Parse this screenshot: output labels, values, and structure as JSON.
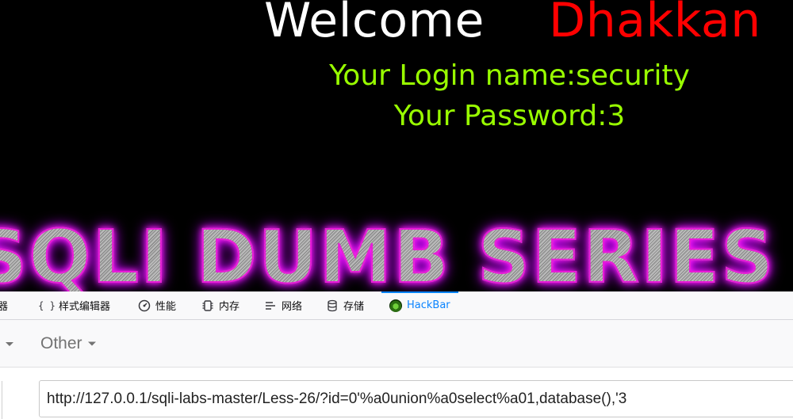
{
  "page": {
    "welcome": "Welcome",
    "username_display": "Dhakkan",
    "login_line": "Your Login name:security",
    "password_line": "Your Password:3",
    "banner": "SQLI DUMB SERIES"
  },
  "devtools": {
    "tabs": [
      {
        "label": "器",
        "icon": "partial-icon"
      },
      {
        "label": "样式编辑器",
        "icon": "braces-icon"
      },
      {
        "label": "性能",
        "icon": "gauge-icon"
      },
      {
        "label": "内存",
        "icon": "memory-chip-icon"
      },
      {
        "label": "网络",
        "icon": "network-lines-icon"
      },
      {
        "label": "存储",
        "icon": "database-icon"
      },
      {
        "label": "HackBar",
        "icon": "hackbar-logo-icon",
        "active": true
      }
    ],
    "accent_color": "#0a84ff"
  },
  "hackbar": {
    "menu_other": "Other",
    "url_value": "http://127.0.0.1/sqli-labs-master/Less-26/?id=0'%a0union%a0select%a01,database(),'3"
  },
  "colors": {
    "welcome": "#ffffff",
    "username": "#ff0000",
    "info_text": "#99ff00",
    "banner_glow": "#ff1ef2"
  }
}
